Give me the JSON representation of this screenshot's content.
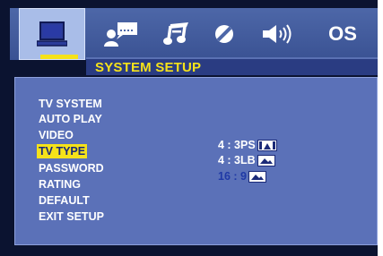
{
  "colors": {
    "highlight": "#f5e21a",
    "panel": "#5b71b8",
    "selected_option": "#1f39a6"
  },
  "tabs": [
    {
      "name": "general-setup",
      "icon": "monitor-icon"
    },
    {
      "name": "speaker",
      "icon": "speaker-person-icon"
    },
    {
      "name": "audio",
      "icon": "music-note-icon"
    },
    {
      "name": "video",
      "icon": "disc-icon"
    },
    {
      "name": "sound",
      "icon": "volume-icon"
    },
    {
      "name": "os",
      "label": "OS"
    }
  ],
  "header": {
    "title": "SYSTEM SETUP"
  },
  "menu": {
    "items": [
      {
        "label": "TV SYSTEM"
      },
      {
        "label": "AUTO PLAY"
      },
      {
        "label": "VIDEO"
      },
      {
        "label": "TV TYPE",
        "selected": true
      },
      {
        "label": "PASSWORD"
      },
      {
        "label": "RATING"
      },
      {
        "label": "DEFAULT"
      },
      {
        "label": "EXIT SETUP"
      }
    ]
  },
  "options": [
    {
      "label": "4 : 3PS",
      "icon": "pan-scan-icon",
      "selected": false
    },
    {
      "label": "4 : 3LB",
      "icon": "letterbox-icon",
      "selected": false
    },
    {
      "label": "16 : 9",
      "icon": "widescreen-icon",
      "selected": true
    }
  ]
}
